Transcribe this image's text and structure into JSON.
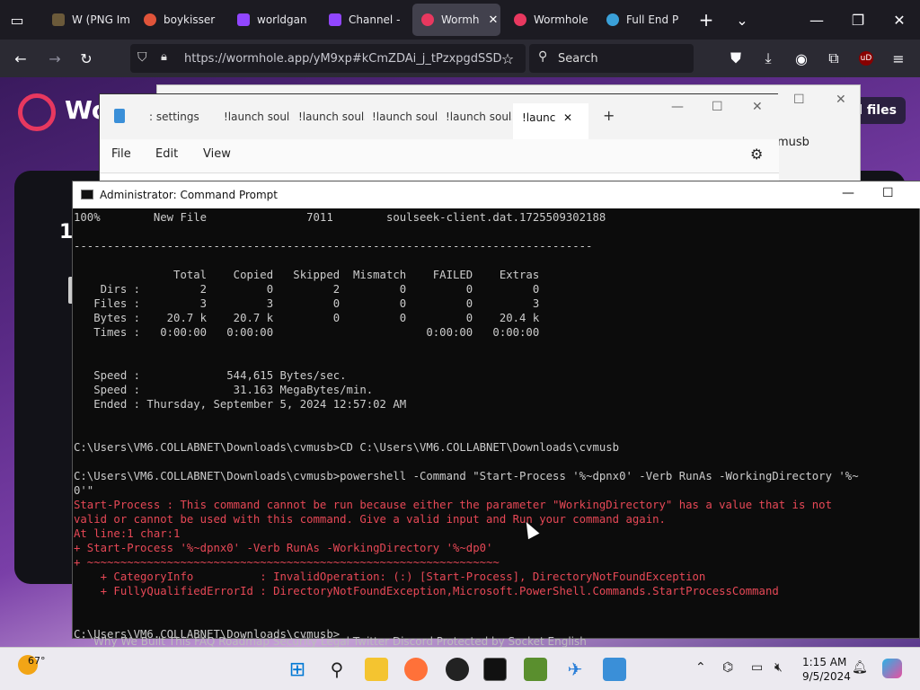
{
  "browser": {
    "tabs": [
      {
        "label": "W (PNG Im",
        "color": "#6b5a3a"
      },
      {
        "label": "boykisser",
        "color": "#e0543a"
      },
      {
        "label": "worldgan",
        "color": "#9146ff"
      },
      {
        "label": "Channel -",
        "color": "#9146ff"
      },
      {
        "label": "Wormh",
        "color": "#e8385f"
      },
      {
        "label": "Wormhole",
        "color": "#e8385f"
      },
      {
        "label": "Full End P",
        "color": "#3aa0d8"
      }
    ],
    "url": "https://wormhole.app/yM9xp#kCmZDAi_j_tPzxpgdSSD",
    "search_placeholder": "Search",
    "ublock_badge": "uD"
  },
  "wormhole": {
    "logo_text": "Wo",
    "card_number": "1",
    "add_files": "d files"
  },
  "explorer": {
    "crumb": "musb"
  },
  "notepad": {
    "tabs": [
      ": settings",
      "!launch souls",
      "!launch souls",
      "!launch souls",
      "!launch souls",
      "!launc"
    ],
    "menu": [
      "File",
      "Edit",
      "View"
    ]
  },
  "cmd": {
    "title": "Administrator: Command Prompt",
    "lines": [
      {
        "text": "100%        New File               7011        soulseek-client.dat.1725509302188",
        "err": false
      },
      {
        "text": "",
        "err": false
      },
      {
        "text": "------------------------------------------------------------------------------",
        "err": false
      },
      {
        "text": "",
        "err": false
      },
      {
        "text": "               Total    Copied   Skipped  Mismatch    FAILED    Extras",
        "err": false
      },
      {
        "text": "    Dirs :         2         0         2         0         0         0",
        "err": false
      },
      {
        "text": "   Files :         3         3         0         0         0         3",
        "err": false
      },
      {
        "text": "   Bytes :    20.7 k    20.7 k         0         0         0    20.4 k",
        "err": false
      },
      {
        "text": "   Times :   0:00:00   0:00:00                       0:00:00   0:00:00",
        "err": false
      },
      {
        "text": "",
        "err": false
      },
      {
        "text": "",
        "err": false
      },
      {
        "text": "   Speed :             544,615 Bytes/sec.",
        "err": false
      },
      {
        "text": "   Speed :              31.163 MegaBytes/min.",
        "err": false
      },
      {
        "text": "   Ended : Thursday, September 5, 2024 12:57:02 AM",
        "err": false
      },
      {
        "text": "",
        "err": false
      },
      {
        "text": "",
        "err": false
      },
      {
        "text": "C:\\Users\\VM6.COLLABNET\\Downloads\\cvmusb>CD C:\\Users\\VM6.COLLABNET\\Downloads\\cvmusb",
        "err": false
      },
      {
        "text": "",
        "err": false
      },
      {
        "text": "C:\\Users\\VM6.COLLABNET\\Downloads\\cvmusb>powershell -Command \"Start-Process '%~dpnx0' -Verb RunAs -WorkingDirectory '%~",
        "err": false
      },
      {
        "text": "0'\"",
        "err": false
      },
      {
        "text": "Start-Process : This command cannot be run because either the parameter \"WorkingDirectory\" has a value that is not",
        "err": true
      },
      {
        "text": "valid or cannot be used with this command. Give a valid input and Run your command again.",
        "err": true
      },
      {
        "text": "At line:1 char:1",
        "err": true
      },
      {
        "text": "+ Start-Process '%~dpnx0' -Verb RunAs -WorkingDirectory '%~dp0'",
        "err": true
      },
      {
        "text": "+ ~~~~~~~~~~~~~~~~~~~~~~~~~~~~~~~~~~~~~~~~~~~~~~~~~~~~~~~~~~~~~~",
        "err": true
      },
      {
        "text": "    + CategoryInfo          : InvalidOperation: (:) [Start-Process], DirectoryNotFoundException",
        "err": true
      },
      {
        "text": "    + FullyQualifiedErrorId : DirectoryNotFoundException,Microsoft.PowerShell.Commands.StartProcessCommand",
        "err": true
      },
      {
        "text": "",
        "err": false
      },
      {
        "text": "",
        "err": false
      },
      {
        "text": "C:\\Users\\VM6.COLLABNET\\Downloads\\cvmusb>_",
        "err": false
      }
    ]
  },
  "footer_links": "Why We Built This       FAQ       Roadmap       Security       Legal       Twitter       Discord       Protected by Socket            English",
  "taskbar": {
    "weather_temp": "67°",
    "time": "1:15 AM",
    "date": "9/5/2024"
  }
}
